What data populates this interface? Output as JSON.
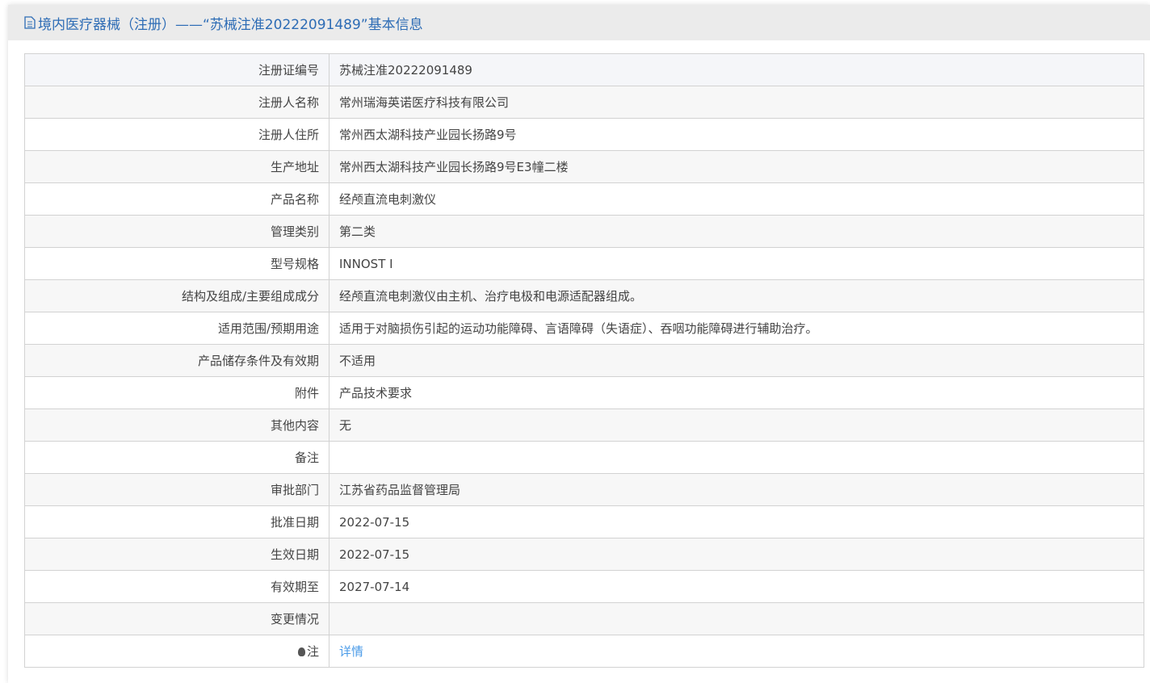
{
  "title": "境内医疗器械（注册）——“苏械注准20222091489”基本信息",
  "rows": [
    {
      "label": "注册证编号",
      "value": "苏械注准20222091489"
    },
    {
      "label": "注册人名称",
      "value": "常州瑞海英诺医疗科技有限公司"
    },
    {
      "label": "注册人住所",
      "value": "常州西太湖科技产业园长扬路9号"
    },
    {
      "label": "生产地址",
      "value": "常州西太湖科技产业园长扬路9号E3幢二楼"
    },
    {
      "label": "产品名称",
      "value": "经颅直流电刺激仪"
    },
    {
      "label": "管理类别",
      "value": "第二类"
    },
    {
      "label": "型号规格",
      "value": "INNOST Ⅰ"
    },
    {
      "label": "结构及组成/主要组成成分",
      "value": "经颅直流电刺激仪由主机、治疗电极和电源适配器组成。"
    },
    {
      "label": "适用范围/预期用途",
      "value": "适用于对脑损伤引起的运动功能障碍、言语障碍（失语症）、吞咽功能障碍进行辅助治疗。"
    },
    {
      "label": "产品储存条件及有效期",
      "value": "不适用"
    },
    {
      "label": "附件",
      "value": "产品技术要求"
    },
    {
      "label": "其他内容",
      "value": "无"
    },
    {
      "label": "备注",
      "value": ""
    },
    {
      "label": "审批部门",
      "value": "江苏省药品监督管理局"
    },
    {
      "label": "批准日期",
      "value": "2022-07-15"
    },
    {
      "label": "生效日期",
      "value": "2022-07-15"
    },
    {
      "label": "有效期至",
      "value": "2027-07-14"
    },
    {
      "label": "变更情况",
      "value": ""
    }
  ],
  "note": {
    "label": "注",
    "link": "详情"
  }
}
